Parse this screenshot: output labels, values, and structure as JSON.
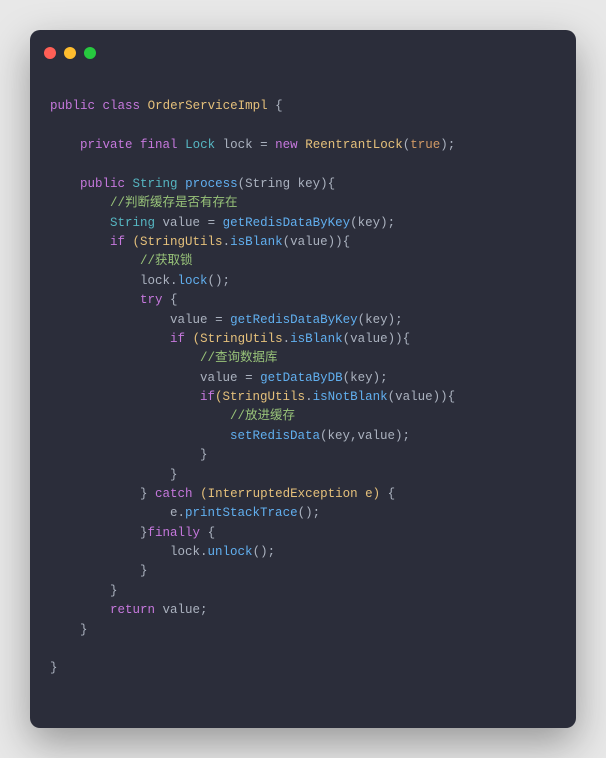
{
  "code": {
    "t01": "public",
    "t02": "class",
    "t03": "OrderServiceImpl",
    "t04": "{",
    "t05": "private",
    "t06": "final",
    "t07": "Lock",
    "t08": "lock",
    "t09": "=",
    "t10": "new",
    "t11": "ReentrantLock",
    "t12": "(",
    "t13": "true",
    "t14": ");",
    "t15": "public",
    "t16": "String",
    "t17": "process",
    "t18": "(String key){",
    "t19": "//判断缓存是否有存在",
    "t20": "String",
    "t21": "value",
    "t22": "=",
    "t23": "getRedisDataByKey",
    "t24": "(key);",
    "t25": "if",
    "t26": "(StringUtils",
    "t27": ".",
    "t28": "isBlank",
    "t29": "(value)){",
    "t30": "//获取锁",
    "t31": "lock.",
    "t32": "lock",
    "t33": "();",
    "t34": "try",
    "t35": "{",
    "t36": "value",
    "t37": "=",
    "t38": "getRedisDataByKey",
    "t39": "(key);",
    "t40": "if",
    "t41": "(StringUtils",
    "t42": ".",
    "t43": "isBlank",
    "t44": "(value)){",
    "t45": "//查询数据库",
    "t46": "value",
    "t47": "=",
    "t48": "getDataByDB",
    "t49": "(key);",
    "t50": "if",
    "t51": "(StringUtils",
    "t52": ".",
    "t53": "isNotBlank",
    "t54": "(value)){",
    "t55": "//放进缓存",
    "t56": "setRedisData",
    "t57": "(key,value);",
    "t58": "}",
    "t59": "}",
    "t60": "}",
    "t61": "catch",
    "t62": "(InterruptedException e)",
    "t63": "{",
    "t64": "e.",
    "t65": "printStackTrace",
    "t66": "();",
    "t67": "}",
    "t68": "finally",
    "t69": "{",
    "t70": "lock.",
    "t71": "unlock",
    "t72": "();",
    "t73": "}",
    "t74": "}",
    "t75": "return",
    "t76": "value;",
    "t77": "}",
    "t78": "}"
  }
}
